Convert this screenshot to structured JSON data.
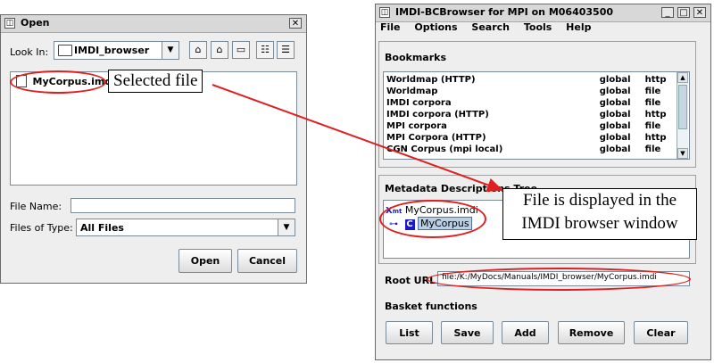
{
  "open_dialog": {
    "title": "Open",
    "look_in_label": "Look In:",
    "look_in_value": "IMDI_browser",
    "files": [
      "MyCorpus.imdi"
    ],
    "file_name_label": "File Name:",
    "file_name_value": "",
    "files_of_type_label": "Files of Type:",
    "files_of_type_value": "All Files",
    "open_button": "Open",
    "cancel_button": "Cancel"
  },
  "browser": {
    "title": "IMDI-BCBrowser for MPI on M06403500",
    "menu": [
      "File",
      "Options",
      "Search",
      "Tools",
      "Help"
    ],
    "bookmarks_label": "Bookmarks",
    "bookmarks": [
      {
        "name": "Worldmap (HTTP)",
        "scope": "global",
        "protocol": "http"
      },
      {
        "name": "Worldmap",
        "scope": "global",
        "protocol": "file"
      },
      {
        "name": "IMDI corpora",
        "scope": "global",
        "protocol": "file"
      },
      {
        "name": "IMDI corpora (HTTP)",
        "scope": "global",
        "protocol": "http"
      },
      {
        "name": "MPI corpora",
        "scope": "global",
        "protocol": "file"
      },
      {
        "name": "MPI Corpora (HTTP)",
        "scope": "global",
        "protocol": "http"
      },
      {
        "name": "CGN Corpus (mpi local)",
        "scope": "global",
        "protocol": "file"
      }
    ],
    "metadata_label": "Metadata Descriptions Tree",
    "tree_root": "MyCorpus.imdi",
    "tree_child": "MyCorpus",
    "root_url_label": "Root URL",
    "root_url_value": "file:/K:/MyDocs/Manuals/IMDI_browser/MyCorpus.imdi",
    "basket_label": "Basket functions",
    "basket_buttons": [
      "List",
      "Save",
      "Add",
      "Remove",
      "Clear"
    ]
  },
  "annotations": {
    "selected_file": "Selected file",
    "displayed_line1": "File is displayed in the",
    "displayed_line2": "IMDI browser window"
  },
  "colors": {
    "arrow": "#e02020",
    "selection": "#b8cfe5",
    "tree_icon": "#1a1ac8"
  }
}
